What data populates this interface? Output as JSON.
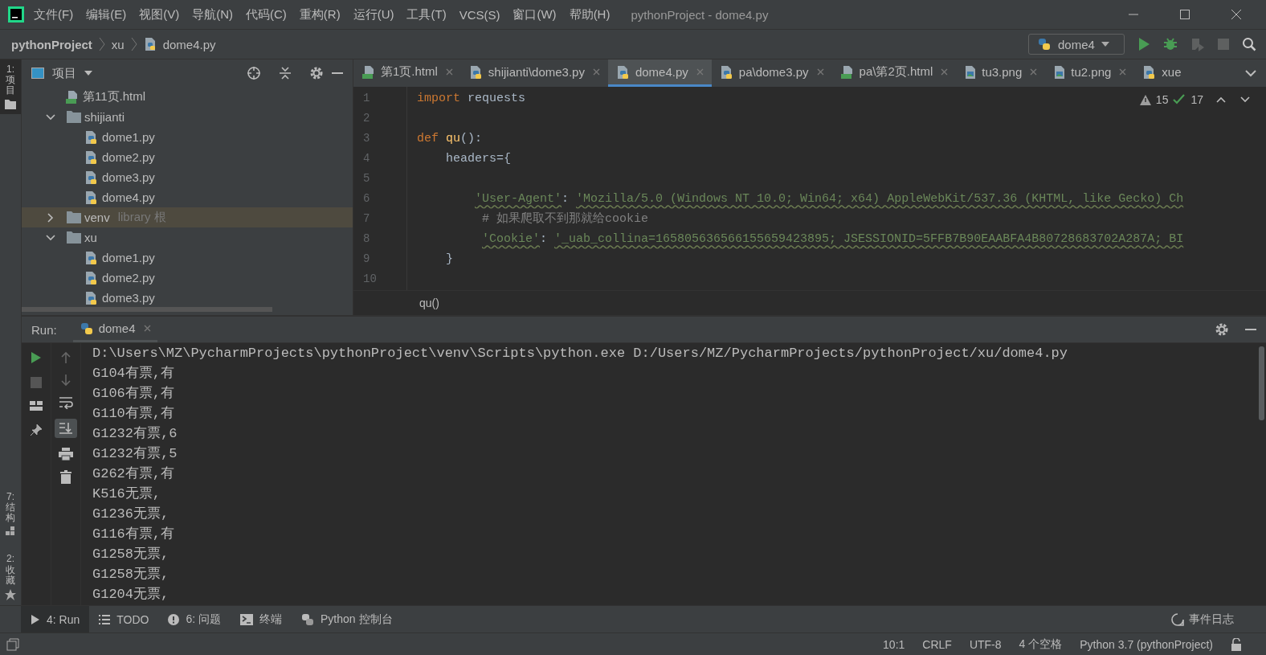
{
  "window": {
    "title": "pythonProject - dome4.py"
  },
  "menu": [
    "文件(F)",
    "编辑(E)",
    "视图(V)",
    "导航(N)",
    "代码(C)",
    "重构(R)",
    "运行(U)",
    "工具(T)",
    "VCS(S)",
    "窗口(W)",
    "帮助(H)"
  ],
  "breadcrumb": [
    "pythonProject",
    "xu",
    "dome4.py"
  ],
  "run_config": "dome4",
  "left_strip": [
    "1: 项目",
    "7: 结构",
    "2: 收藏"
  ],
  "project_panel": {
    "title": "项目",
    "tree": [
      {
        "label": "第11页.html",
        "kind": "html",
        "selected": false
      },
      {
        "label": "shijianti",
        "kind": "folder",
        "expanded": true,
        "selected": false,
        "children": [
          {
            "label": "dome1.py",
            "kind": "python",
            "selected": false
          },
          {
            "label": "dome2.py",
            "kind": "python",
            "selected": false
          },
          {
            "label": "dome3.py",
            "kind": "python",
            "selected": false
          },
          {
            "label": "dome4.py",
            "kind": "python",
            "selected": false
          }
        ]
      },
      {
        "label": "venv",
        "note": "library 根",
        "kind": "folder",
        "expanded": false,
        "selected": true
      },
      {
        "label": "xu",
        "kind": "folder",
        "expanded": true,
        "selected": false,
        "children": [
          {
            "label": "dome1.py",
            "kind": "python",
            "selected": false
          },
          {
            "label": "dome2.py",
            "kind": "python",
            "selected": false
          },
          {
            "label": "dome3.py",
            "kind": "python",
            "selected": false
          }
        ]
      }
    ]
  },
  "editor_tabs": [
    {
      "label": "第1页.html",
      "kind": "html",
      "selected": false
    },
    {
      "label": "shijianti\\dome3.py",
      "kind": "python",
      "selected": false
    },
    {
      "label": "dome4.py",
      "kind": "python",
      "selected": true
    },
    {
      "label": "pa\\dome3.py",
      "kind": "python",
      "selected": false
    },
    {
      "label": "pa\\第2页.html",
      "kind": "html",
      "selected": false
    },
    {
      "label": "tu3.png",
      "kind": "image",
      "selected": false
    },
    {
      "label": "tu2.png",
      "kind": "image",
      "selected": false
    },
    {
      "label": "xue",
      "kind": "python",
      "selected": false
    }
  ],
  "inspections": {
    "warnings": "15",
    "ok": "17"
  },
  "code": [
    {
      "number": "1",
      "tokens": [
        {
          "kind": "kw",
          "text": "import"
        },
        {
          "kind": "plain",
          "text": " requests"
        }
      ]
    },
    {
      "number": "2"
    },
    {
      "number": "3",
      "tokens": [
        {
          "kind": "kw",
          "text": "def"
        },
        {
          "kind": "fn",
          "text": " qu"
        },
        {
          "kind": "plain",
          "text": "():"
        }
      ]
    },
    {
      "number": "4",
      "tokens": [
        {
          "kind": "plain",
          "text": "    headers={"
        }
      ]
    },
    {
      "number": "5"
    },
    {
      "number": "6",
      "tokens": [
        {
          "kind": "str",
          "text": "        'User-Agent'"
        },
        {
          "kind": "plain",
          "text": ": "
        },
        {
          "kind": "str",
          "text": "'Mozilla/5.0 (Windows NT 10.0; Win64; x64) AppleWebKit/537.36 (KHTML, like Gecko) Ch"
        }
      ]
    },
    {
      "number": "7",
      "tokens": [
        {
          "kind": "comment",
          "text": "         # 如果爬取不到那就给cookie"
        }
      ]
    },
    {
      "number": "8",
      "tokens": [
        {
          "kind": "str",
          "text": "         'Cookie'"
        },
        {
          "kind": "plain",
          "text": ": "
        },
        {
          "kind": "str",
          "text": "'_uab_collina=165805636566155659423895; JSESSIONID=5FFB7B90EAABFA4B80728683702A287A; BI"
        }
      ]
    },
    {
      "number": "9",
      "tokens": [
        {
          "kind": "plain",
          "text": "    }"
        }
      ]
    },
    {
      "number": "10"
    }
  ],
  "editor_footer": "qu()",
  "run": {
    "label": "Run:",
    "tab": "dome4",
    "output": [
      "D:\\Users\\MZ\\PycharmProjects\\pythonProject\\venv\\Scripts\\python.exe D:/Users/MZ/PycharmProjects/pythonProject/xu/dome4.py",
      "G104有票,有",
      "G106有票,有",
      "G110有票,有",
      "G1232有票,6",
      "G1232有票,5",
      "G262有票,有",
      "K516无票,",
      "G1236无票,",
      "G116有票,有",
      "G1258无票,",
      "G1258无票,",
      "G1204无票,"
    ]
  },
  "tool_tabs": [
    {
      "label": "4: Run",
      "kind": "run",
      "selected": true
    },
    {
      "label": "TODO",
      "kind": "list",
      "selected": false
    },
    {
      "label": "6: 问题",
      "kind": "problem",
      "selected": false
    },
    {
      "label": "终端",
      "kind": "terminal",
      "selected": false
    },
    {
      "label": "Python 控制台",
      "kind": "python",
      "selected": false
    }
  ],
  "event_log": "事件日志",
  "status_bar": [
    "10:1",
    "CRLF",
    "UTF-8",
    "4 个空格",
    "Python 3.7 (pythonProject)"
  ]
}
